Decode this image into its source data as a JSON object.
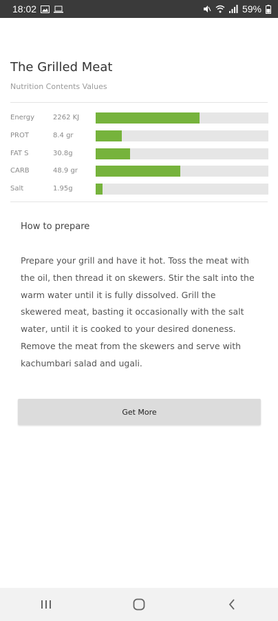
{
  "status_bar": {
    "time": "18:02",
    "battery": "59%",
    "left_icons": [
      "image-icon",
      "laptop-icon"
    ],
    "right_icons": [
      "mute-icon",
      "wifi-icon",
      "signal-icon",
      "battery-icon"
    ]
  },
  "recipe": {
    "title": "The Grilled Meat",
    "subtitle": "Nutrition Contents Values"
  },
  "nutrition": [
    {
      "label": "Energy",
      "value": "2262 KJ",
      "fill": 0.6
    },
    {
      "label": "PROT",
      "value": "8.4 gr",
      "fill": 0.15
    },
    {
      "label": "FAT S",
      "value": "30.8g",
      "fill": 0.2
    },
    {
      "label": "CARB",
      "value": "48.9 gr",
      "fill": 0.49
    },
    {
      "label": "Salt",
      "value": "1.95g",
      "fill": 0.04
    }
  ],
  "bar_color": "#76b33c",
  "how_to": {
    "heading": "How to prepare",
    "body": "Prepare your grill and have it hot. Toss the meat with the oil, then thread it on skewers. Stir the salt into the warm water until it is fully dissolved. Grill the skewered meat, basting it occasionally with the salt water, until it is cooked to your desired doneness. Remove the meat from the skewers and serve with kachumbari salad and ugali."
  },
  "button": {
    "label": "Get More"
  },
  "nav": [
    "recent-apps-icon",
    "home-icon",
    "back-icon"
  ]
}
